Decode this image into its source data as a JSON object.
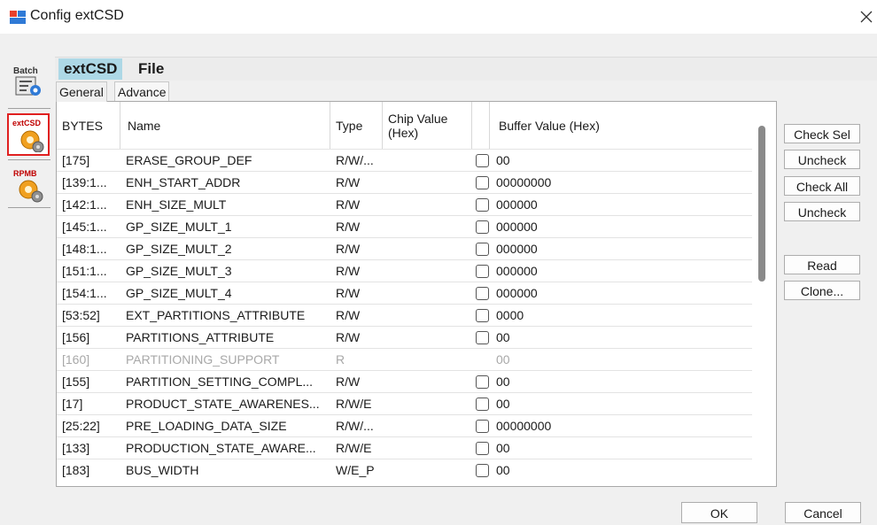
{
  "window": {
    "title": "Config extCSD"
  },
  "sidebar": {
    "items": [
      {
        "name": "batch",
        "label": "Batch"
      },
      {
        "name": "extcsd",
        "label": "extCSD"
      },
      {
        "name": "rpmb",
        "label": "RPMB"
      }
    ]
  },
  "menu": {
    "extcsd_label": "extCSD",
    "file_label": "File"
  },
  "tabs": {
    "general": "General",
    "advance": "Advance"
  },
  "grid": {
    "columns": {
      "bytes": "BYTES",
      "name": "Name",
      "type": "Type",
      "chip": "Chip Value (Hex)",
      "buffer": "Buffer Value (Hex)"
    },
    "rows": [
      {
        "bytes": "[175]",
        "name": "ERASE_GROUP_DEF",
        "type": "R/W/...",
        "chip": "",
        "buffer": "00",
        "checkbox": true,
        "enabled": true
      },
      {
        "bytes": "[139:1...",
        "name": "ENH_START_ADDR",
        "type": "R/W",
        "chip": "",
        "buffer": "00000000",
        "checkbox": true,
        "enabled": true
      },
      {
        "bytes": "[142:1...",
        "name": "ENH_SIZE_MULT",
        "type": "R/W",
        "chip": "",
        "buffer": "000000",
        "checkbox": true,
        "enabled": true
      },
      {
        "bytes": "[145:1...",
        "name": "GP_SIZE_MULT_1",
        "type": "R/W",
        "chip": "",
        "buffer": "000000",
        "checkbox": true,
        "enabled": true
      },
      {
        "bytes": "[148:1...",
        "name": "GP_SIZE_MULT_2",
        "type": "R/W",
        "chip": "",
        "buffer": "000000",
        "checkbox": true,
        "enabled": true
      },
      {
        "bytes": "[151:1...",
        "name": "GP_SIZE_MULT_3",
        "type": "R/W",
        "chip": "",
        "buffer": "000000",
        "checkbox": true,
        "enabled": true
      },
      {
        "bytes": "[154:1...",
        "name": "GP_SIZE_MULT_4",
        "type": "R/W",
        "chip": "",
        "buffer": "000000",
        "checkbox": true,
        "enabled": true
      },
      {
        "bytes": "[53:52]",
        "name": "EXT_PARTITIONS_ATTRIBUTE",
        "type": "R/W",
        "chip": "",
        "buffer": "0000",
        "checkbox": true,
        "enabled": true
      },
      {
        "bytes": "[156]",
        "name": "PARTITIONS_ATTRIBUTE",
        "type": "R/W",
        "chip": "",
        "buffer": "00",
        "checkbox": true,
        "enabled": true
      },
      {
        "bytes": "[160]",
        "name": "PARTITIONING_SUPPORT",
        "type": "R",
        "chip": "",
        "buffer": "00",
        "checkbox": false,
        "enabled": false
      },
      {
        "bytes": "[155]",
        "name": "PARTITION_SETTING_COMPL...",
        "type": "R/W",
        "chip": "",
        "buffer": "00",
        "checkbox": true,
        "enabled": true
      },
      {
        "bytes": "[17]",
        "name": "PRODUCT_STATE_AWARENES...",
        "type": "R/W/E",
        "chip": "",
        "buffer": "00",
        "checkbox": true,
        "enabled": true
      },
      {
        "bytes": "[25:22]",
        "name": "PRE_LOADING_DATA_SIZE",
        "type": "R/W/...",
        "chip": "",
        "buffer": "00000000",
        "checkbox": true,
        "enabled": true
      },
      {
        "bytes": "[133]",
        "name": "PRODUCTION_STATE_AWARE...",
        "type": "R/W/E",
        "chip": "",
        "buffer": "00",
        "checkbox": true,
        "enabled": true
      },
      {
        "bytes": "[183]",
        "name": "BUS_WIDTH",
        "type": "W/E_P",
        "chip": "",
        "buffer": "00",
        "checkbox": true,
        "enabled": true
      }
    ]
  },
  "right_buttons": {
    "check_sel": "Check Sel",
    "uncheck1": "Uncheck",
    "check_all": "Check All",
    "uncheck2": "Uncheck",
    "read": "Read",
    "clone": "Clone..."
  },
  "footer": {
    "ok": "OK",
    "cancel": "Cancel"
  }
}
